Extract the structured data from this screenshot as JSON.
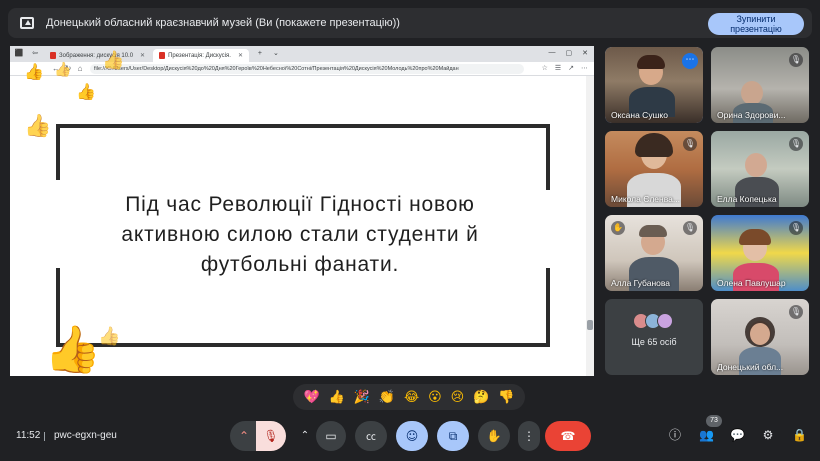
{
  "meeting": {
    "title": "Донецький обласний краєзнавчий музей (Ви (покажете презентацію))",
    "stop_label": "Зупинити презентацію",
    "time": "11:52",
    "code": "pwc-egxn-geu"
  },
  "browser": {
    "tabs": [
      {
        "label": "Зображення: дискусія 10.0",
        "active": false
      },
      {
        "label": "Презентація: Дискусія.",
        "active": true
      }
    ],
    "url": "file:///C:/Users/User/Desktop/Дискусія%20до%20Дня%20Героїв%20Небесної%20Сотні/Презентація%20Дискусія%20Молодь%20про%20Майдан"
  },
  "slide": {
    "line1": "Під час Революції Гідності новою",
    "line2": "активною силою стали студенти й",
    "line3": "футбольні фанати."
  },
  "participants": [
    {
      "name": "Оксана Сушко",
      "muted": false,
      "more_menu": true
    },
    {
      "name": "Орина Здорови...",
      "muted": true
    },
    {
      "name": "Микола Єленва...",
      "muted": true
    },
    {
      "name": "Елла Копецька",
      "muted": true
    },
    {
      "name": "Алла Губанова",
      "muted": true
    },
    {
      "name": "Олена Павлушар",
      "muted": true
    },
    {
      "name": "Донецький обл...",
      "muted": true
    }
  ],
  "more_participants": "Ще 65 осіб",
  "participant_count_badge": "73",
  "reactions": [
    "💖",
    "👍",
    "🎉",
    "👏",
    "😂",
    "😮",
    "😢",
    "🤔",
    "👎"
  ],
  "colors": {
    "background": "#202124",
    "accent_blue": "#a8c7fa",
    "end_call_red": "#ea4335",
    "mic_off_bg": "#f9dedc"
  },
  "icons": {
    "presenting": "presentation-icon",
    "mic": "mic-off-icon",
    "camera": "camera-icon",
    "captions": "captions-icon",
    "emoji": "emoji-icon",
    "present": "present-screen-icon",
    "hand": "raise-hand-icon",
    "more": "more-vert-icon",
    "end": "end-call-icon"
  }
}
